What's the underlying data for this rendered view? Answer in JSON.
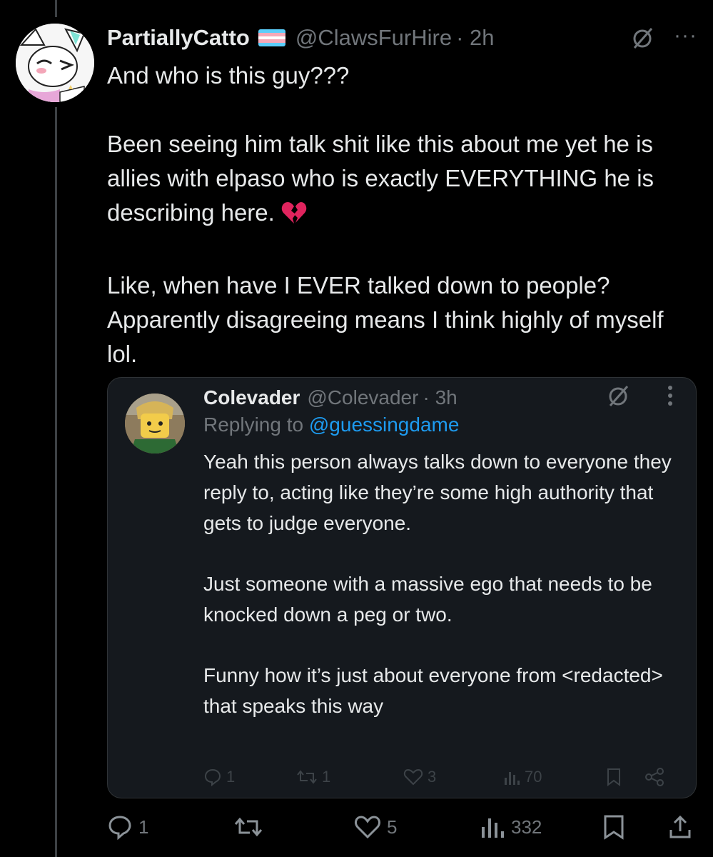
{
  "tweet": {
    "display_name": "PartiallyCatto",
    "handle": "@ClawsFurHire",
    "time": "· 2h",
    "flag_colors": [
      "#5bcefa",
      "#f5a9b8",
      "#ffffff",
      "#f5a9b8",
      "#5bcefa"
    ],
    "body": {
      "p1": "And who is this guy???",
      "p2": "Been seeing him talk shit like this about me yet he is allies with elpaso who is exactly EVERYTHING he is describing here.",
      "p3": "Like, when have I EVER talked down to people? Apparently disagreeing means I think highly of myself lol."
    },
    "emoji_icon": "broken-heart-icon",
    "stats": {
      "replies": "1",
      "likes": "5",
      "views": "332"
    }
  },
  "quote": {
    "display_name": "Colevader",
    "handle": "@Colevader",
    "time": "· 3h",
    "replying_prefix": "Replying to",
    "replying_to": "@guessingdame",
    "body": {
      "p1": "Yeah this person always talks down to everyone they reply to, acting like they’re some high authority that gets to judge everyone.",
      "p2": "Just someone with a massive ego that needs to be knocked down a peg or two.",
      "p3": "Funny how it’s just about everyone from <redacted> that speaks this way"
    },
    "stats": {
      "replies": "1",
      "reposts": "1",
      "likes": "3",
      "views": "70"
    }
  },
  "colors": {
    "background": "#000000",
    "text": "#e7e9ea",
    "muted": "#71767b",
    "link": "#1d9bf0",
    "card": "#15191e"
  }
}
